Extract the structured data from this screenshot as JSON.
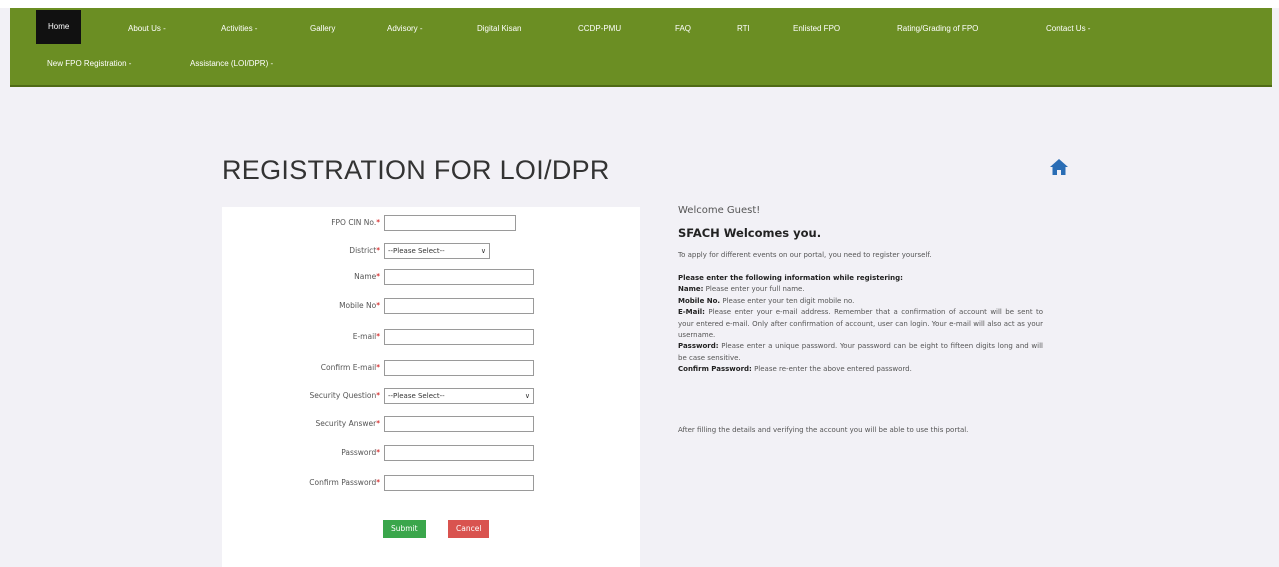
{
  "nav": {
    "row1": [
      {
        "label": "Home",
        "active": true
      },
      {
        "label": "About Us -"
      },
      {
        "label": "Activities -"
      },
      {
        "label": "Gallery"
      },
      {
        "label": "Advisory -"
      },
      {
        "label": "Digital Kisan"
      },
      {
        "label": "CCDP-PMU"
      },
      {
        "label": "FAQ"
      },
      {
        "label": "RTI"
      },
      {
        "label": "Enlisted FPO"
      },
      {
        "label": "Rating/Grading of FPO"
      },
      {
        "label": "Contact Us -"
      }
    ],
    "row2": [
      {
        "label": "New FPO Registration -"
      },
      {
        "label": "Assistance (LOI/DPR) -"
      }
    ]
  },
  "page": {
    "title": "REGISTRATION FOR LOI/DPR",
    "home_icon": "home-icon"
  },
  "form": {
    "fields": [
      {
        "label": "FPO CIN No.",
        "req": "*",
        "type": "text",
        "value": ""
      },
      {
        "label": "District",
        "req": "*",
        "type": "select",
        "value": "--Please Select--"
      },
      {
        "label": "Name",
        "req": "*",
        "type": "text",
        "value": ""
      },
      {
        "label": "Mobile No",
        "req": "*",
        "type": "text",
        "value": ""
      },
      {
        "label": "E-mail",
        "req": "*",
        "type": "text",
        "value": ""
      },
      {
        "label": "Confirm E-mail",
        "req": "*",
        "type": "text",
        "value": ""
      },
      {
        "label": "Security Question",
        "req": "*",
        "type": "select",
        "value": "--Please Select--"
      },
      {
        "label": "Security Answer",
        "req": "*",
        "type": "text",
        "value": ""
      },
      {
        "label": "Password",
        "req": "*",
        "type": "password",
        "value": ""
      },
      {
        "label": "Confirm Password",
        "req": "*",
        "type": "password",
        "value": ""
      }
    ],
    "submit_label": "Submit",
    "cancel_label": "Cancel"
  },
  "info": {
    "welcome_guest": "Welcome Guest!",
    "welcome_title": "SFACH Welcomes you.",
    "intro": "To apply for different events on our portal, you need to register yourself.",
    "guide_heading": "Please enter the following information while registering:",
    "items": [
      {
        "term": "Name:",
        "text": "Please enter your full name."
      },
      {
        "term": "Mobile No.",
        "text": "Please enter your ten digit mobile no."
      },
      {
        "term": "E-Mail:",
        "text": "Please enter your e-mail address. Remember that a confirmation of account will be sent to your entered e-mail. Only after confirmation of account, user can login. Your e-mail will also act as your username."
      },
      {
        "term": "Password:",
        "text": "Please enter a unique password. Your password can be eight to fifteen digits long and will be case sensitive."
      },
      {
        "term": "Confirm Password:",
        "text": "Please re-enter the above entered password."
      }
    ],
    "after": "After filling the details and verifying the account you will be able to use this portal."
  },
  "colors": {
    "nav_bg": "#6b8e23",
    "active_nav": "#111111",
    "submit": "#3aa64b",
    "cancel": "#d9534f",
    "home_icon": "#2a6db5"
  }
}
